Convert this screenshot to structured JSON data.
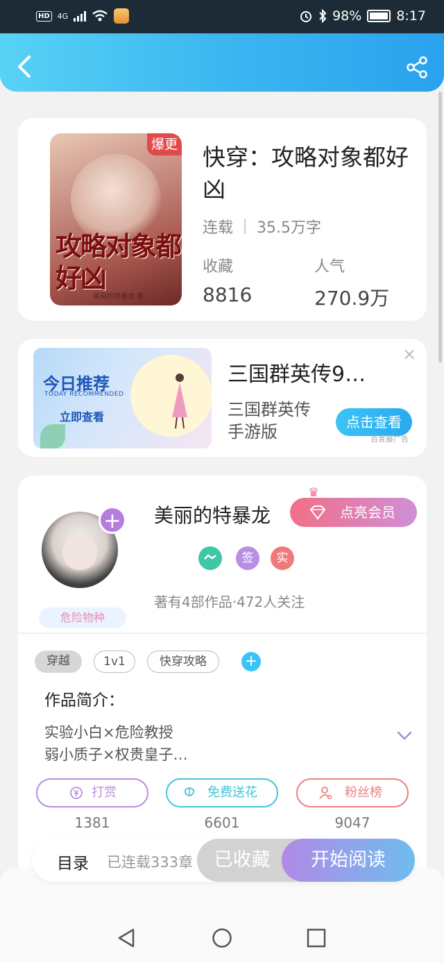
{
  "status_bar": {
    "hd": "HD",
    "network": "4G",
    "battery": "98%",
    "time": "8:17"
  },
  "book": {
    "cover_badge": "爆更",
    "cover_title_art": "攻略对象都好凶",
    "cover_author_art": "美丽的特暴龙 著",
    "title": "快穿：攻略对象都好凶",
    "status": "连载",
    "word_count": "35.5万字",
    "favorites_label": "收藏",
    "favorites_value": "8816",
    "popularity_label": "人气",
    "popularity_value": "270.9万"
  },
  "ad": {
    "banner_title": "今日推荐",
    "banner_subtitle": "TODAY RECOMMENDED",
    "banner_cta": "立即查看",
    "title": "三国群英传9…",
    "subtitle": "三国群英传手游版",
    "button": "点击查看",
    "source": "百青藤广告",
    "close": "×"
  },
  "author": {
    "name": "美丽的特暴龙",
    "vip_label": "点亮会员",
    "tag": "危险物种",
    "badges": [
      "签",
      "实"
    ],
    "stats": "著有4部作品·472人关注"
  },
  "tags": [
    "穿越",
    "1v1",
    "快穿攻略"
  ],
  "intro": {
    "label": "作品简介：",
    "lines": [
      "实验小白×危险教授",
      "弱小质子×权贵皇子…"
    ]
  },
  "actions": [
    {
      "label": "打赏",
      "count": "1381",
      "color": "#b98ee0"
    },
    {
      "label": "免费送花",
      "count": "6601",
      "color": "#3fc6d8"
    },
    {
      "label": "粉丝榜",
      "count": "9047",
      "color": "#ec7f7f"
    }
  ],
  "bottom_bar": {
    "toc_label": "目录",
    "toc_count": "已连载333章",
    "favorited_label": "已收藏",
    "read_label": "开始阅读"
  },
  "colors": {
    "header_gradient_start": "#58d2f5",
    "header_gradient_end": "#2aa2ee",
    "accent_purple": "#b37ee0",
    "vip_pink": "#f26f87"
  },
  "icons": [
    "back-icon",
    "share-icon",
    "close-icon",
    "diamond-icon",
    "crown-icon",
    "plus-icon",
    "chevron-down-icon",
    "coin-icon",
    "flower-icon",
    "fans-icon",
    "nav-back-icon",
    "nav-home-icon",
    "nav-recents-icon"
  ]
}
